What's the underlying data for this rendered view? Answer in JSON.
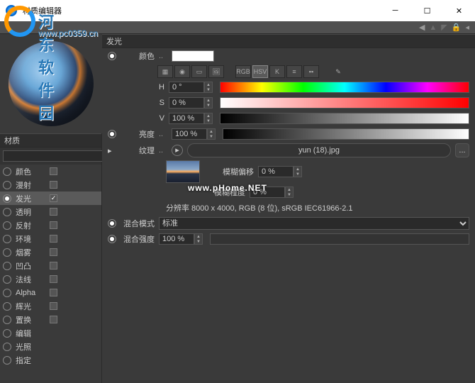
{
  "window": {
    "title": "材质编辑器"
  },
  "logo": {
    "text": "河东软件园",
    "url": "www.pc0359.cn"
  },
  "watermark": "www.pHome.NET",
  "left": {
    "section": "材质",
    "channels": [
      {
        "label": "颜色",
        "enabled": false
      },
      {
        "label": "漫射",
        "enabled": false
      },
      {
        "label": "发光",
        "enabled": true,
        "active": true
      },
      {
        "label": "透明",
        "enabled": false
      },
      {
        "label": "反射",
        "enabled": false
      },
      {
        "label": "环境",
        "enabled": false
      },
      {
        "label": "烟雾",
        "enabled": false
      },
      {
        "label": "凹凸",
        "enabled": false
      },
      {
        "label": "法线",
        "enabled": false
      },
      {
        "label": "Alpha",
        "enabled": false
      },
      {
        "label": "辉光",
        "enabled": false
      },
      {
        "label": "置换",
        "enabled": false
      },
      {
        "label": "编辑"
      },
      {
        "label": "光照"
      },
      {
        "label": "指定"
      }
    ]
  },
  "panel": {
    "title": "发光",
    "color_label": "颜色",
    "tools": {
      "rgb": "RGB",
      "hsv": "HSV",
      "k": "K"
    },
    "hsv": {
      "h_label": "H",
      "h": "0 °",
      "s_label": "S",
      "s": "0 %",
      "v_label": "V",
      "v": "100 %"
    },
    "brightness": {
      "label": "亮度",
      "value": "100 %"
    },
    "texture": {
      "label": "纹理",
      "file": "yun (18).jpg",
      "blur_offset_label": "模糊偏移",
      "blur_offset": "0 %",
      "blur_scale_label": "模糊程度",
      "blur_scale": "0 %",
      "info": "分辨率 8000 x 4000, RGB (8 位), sRGB IEC61966-2.1"
    },
    "blend_mode": {
      "label": "混合模式",
      "value": "标准"
    },
    "blend_strength": {
      "label": "混合强度",
      "value": "100 %"
    }
  }
}
